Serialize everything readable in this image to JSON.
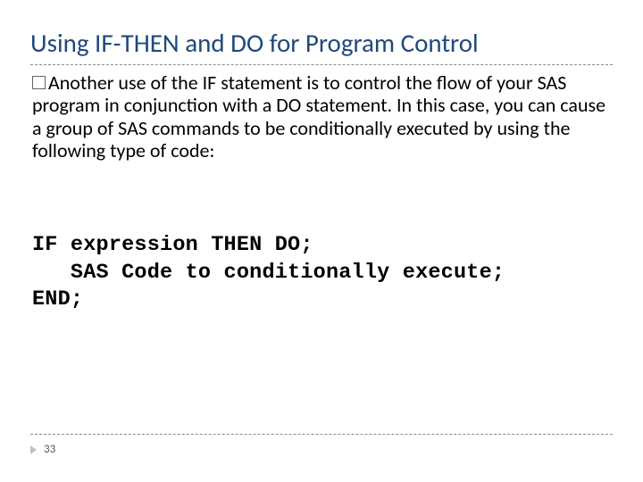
{
  "title": "Using IF-THEN and DO for Program Control",
  "paragraph": "Another use of the IF statement is to control the flow of your SAS program in conjunction with a DO statement. In this case, you can cause a group of SAS commands to be conditionally executed by using the following type of code:",
  "code_line1": "IF expression THEN DO;",
  "code_line2": "   SAS Code to conditionally execute;",
  "code_line3": "END;",
  "page_number": "33"
}
